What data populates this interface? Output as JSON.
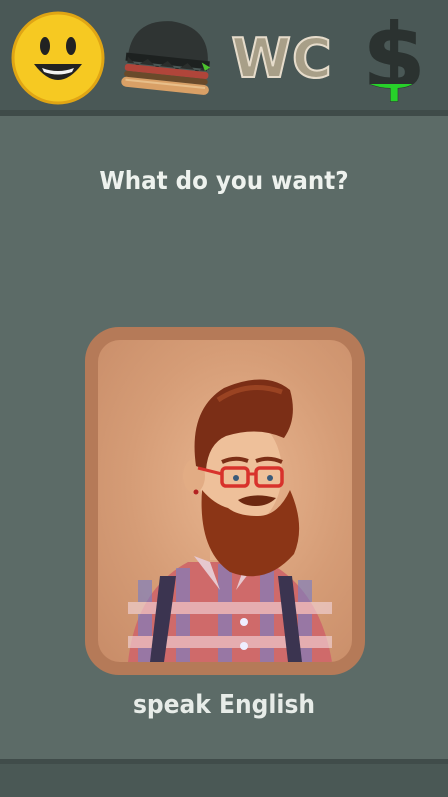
{
  "topbar": {
    "items": [
      {
        "icon": "smiley-face-icon"
      },
      {
        "icon": "burger-icon"
      },
      {
        "icon": "wc-icon",
        "label": "WC"
      },
      {
        "icon": "dollar-icon",
        "label": "$"
      }
    ]
  },
  "prompt": "What do you want?",
  "card": {
    "icon": "bearded-hipster-portrait",
    "caption": "speak English"
  },
  "colors": {
    "background": "#5c6b67",
    "topbar": "#4a5856",
    "card_frame": "#b57a58",
    "smiley": "#f6c922",
    "dollar_green": "#27d12a"
  }
}
